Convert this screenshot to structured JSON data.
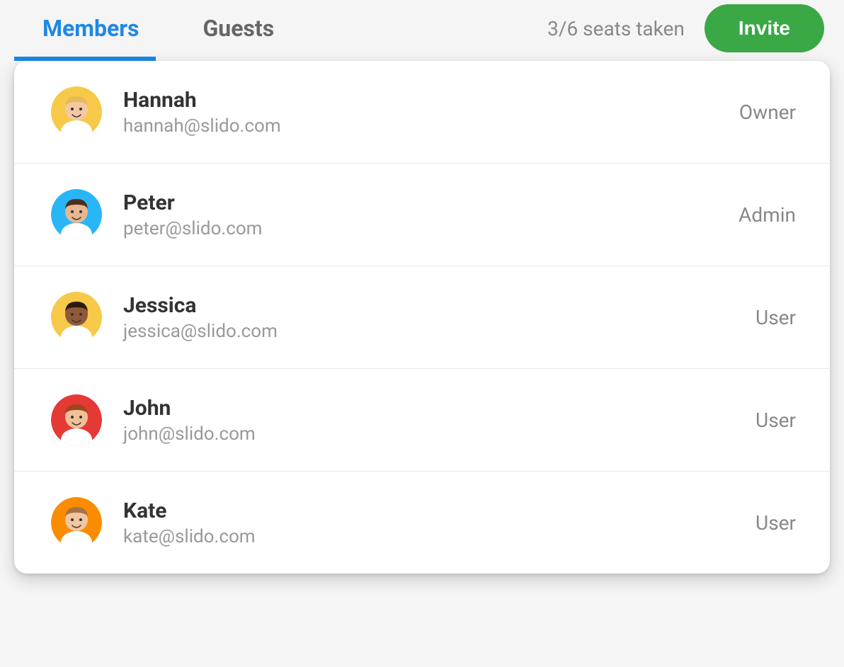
{
  "tabs": {
    "members": "Members",
    "guests": "Guests"
  },
  "seats_text": "3/6 seats taken",
  "invite_label": "Invite",
  "members": [
    {
      "name": "Hannah",
      "email": "hannah@slido.com",
      "role": "Owner",
      "avatar_bg": "#f7c948",
      "avatar_skin": "#f3c9a5",
      "avatar_hair": "#e8b95c"
    },
    {
      "name": "Peter",
      "email": "peter@slido.com",
      "role": "Admin",
      "avatar_bg": "#29b6f6",
      "avatar_skin": "#e8b78f",
      "avatar_hair": "#4a3020"
    },
    {
      "name": "Jessica",
      "email": "jessica@slido.com",
      "role": "User",
      "avatar_bg": "#f7c948",
      "avatar_skin": "#8d5a3a",
      "avatar_hair": "#2a1a10"
    },
    {
      "name": "John",
      "email": "john@slido.com",
      "role": "User",
      "avatar_bg": "#e53935",
      "avatar_skin": "#f0c097",
      "avatar_hair": "#a0461e"
    },
    {
      "name": "Kate",
      "email": "kate@slido.com",
      "role": "User",
      "avatar_bg": "#fb8c00",
      "avatar_skin": "#f2c6a0",
      "avatar_hair": "#a57243"
    }
  ]
}
